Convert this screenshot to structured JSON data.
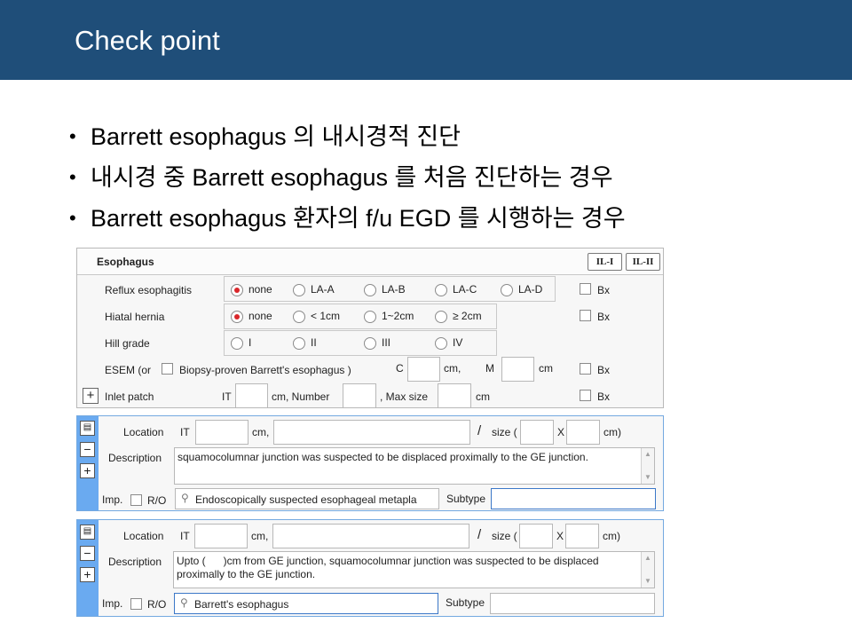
{
  "header": {
    "title": "Check point",
    "bg": "#1f4e79"
  },
  "bullets": [
    "Barrett esophagus 의 내시경적 진단",
    "내시경 중 Barrett esophagus 를 처음 진단하는 경우",
    "Barrett esophagus 환자의 f/u EGD 를 시행하는 경우"
  ],
  "esophagus_panel": {
    "title": "Esophagus",
    "il_buttons": [
      "IL-I",
      "IL-II"
    ],
    "reflux": {
      "label": "Reflux esophagitis",
      "options": [
        "none",
        "LA-A",
        "LA-B",
        "LA-C",
        "LA-D"
      ],
      "selected": "none",
      "bx": "Bx"
    },
    "hiatal": {
      "label": "Hiatal hernia",
      "options": [
        "none",
        "< 1cm",
        "1~2cm",
        "≥ 2cm"
      ],
      "selected": "none",
      "bx": "Bx"
    },
    "hill": {
      "label": "Hill grade",
      "options": [
        "I",
        "II",
        "III",
        "IV"
      ],
      "selected": "",
      "bx": ""
    },
    "esem": {
      "label": "ESEM (or",
      "checkbox_label": "Biopsy-proven Barrett's esophagus )",
      "c_label": "C",
      "cm1": "cm,",
      "m_label": "M",
      "cm2": "cm",
      "bx": "Bx",
      "c_value": "",
      "m_value": ""
    },
    "inlet": {
      "label": "Inlet patch",
      "it_label": "IT",
      "cm_number": "cm, Number",
      "max_size": ", Max size",
      "cm": "cm",
      "bx": "Bx",
      "it_value": "",
      "number_value": "",
      "max_value": ""
    }
  },
  "findings": [
    {
      "location_label": "Location",
      "it_label": "IT",
      "cm_label": "cm,",
      "slash": "/",
      "size_label": "size (",
      "x_label": "X",
      "cm_close": "cm)",
      "description_label": "Description",
      "description": "squamocolumnar junction was suspected to be displaced proximally to the GE junction.",
      "imp_label": "Imp.",
      "ro_label": "R/O",
      "impression": "Endoscopically suspected esophageal metapla",
      "subtype_label": "Subtype",
      "subtype_value": ""
    },
    {
      "location_label": "Location",
      "it_label": "IT",
      "cm_label": "cm,",
      "slash": "/",
      "size_label": "size (",
      "x_label": "X",
      "cm_close": "cm)",
      "description_label": "Description",
      "description": "Upto (      )cm from GE junction, squamocolumnar junction was suspected to be displaced proximally to the GE junction.",
      "imp_label": "Imp.",
      "ro_label": "R/O",
      "impression": "Barrett's esophagus",
      "subtype_label": "Subtype",
      "subtype_value": ""
    }
  ],
  "colors": {
    "accent_blue": "#6aaaf0",
    "radio_selected": "#d9262a",
    "focus_border": "#3c78c8"
  }
}
